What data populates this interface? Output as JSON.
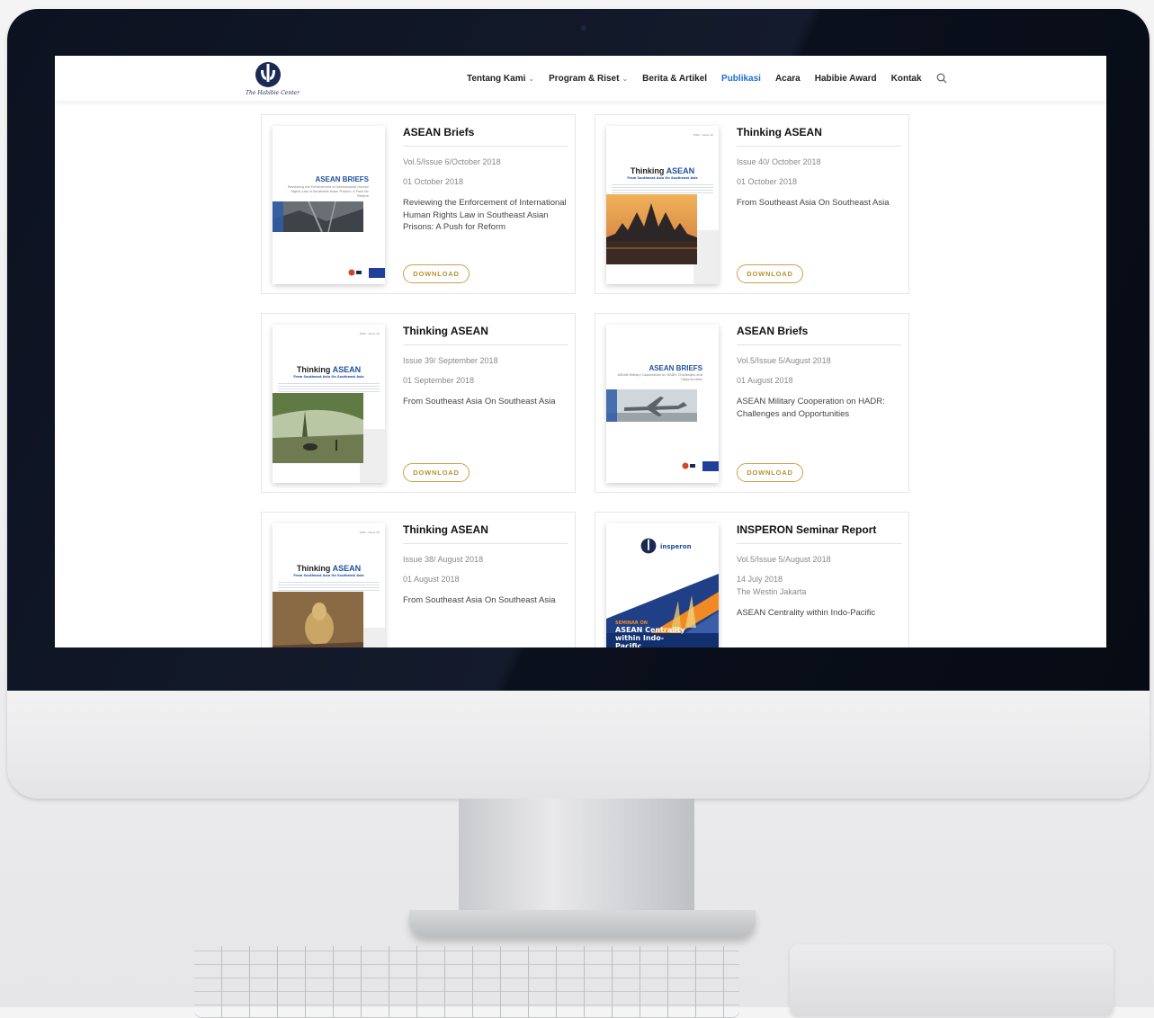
{
  "header": {
    "logo_text": "The Habibie Center",
    "nav": [
      {
        "label": "Tentang Kami",
        "has_caret": true
      },
      {
        "label": "Program & Riset",
        "has_caret": true
      },
      {
        "label": "Berita & Artikel",
        "has_caret": false
      },
      {
        "label": "Publikasi",
        "has_caret": false,
        "active": true
      },
      {
        "label": "Acara",
        "has_caret": false
      },
      {
        "label": "Habibie Award",
        "has_caret": false
      },
      {
        "label": "Kontak",
        "has_caret": false
      }
    ],
    "search_icon": "search-icon"
  },
  "publications": [
    {
      "title": "ASEAN Briefs",
      "issue": "Vol.5/Issue 6/October 2018",
      "date": "01 October 2018",
      "description": "Reviewing the Enforcement of International Human Rights Law in Southeast Asian Prisons: A Push for Reform",
      "button": "DOWNLOAD",
      "cover": {
        "heading": "ASEAN BRIEFS",
        "subtitle": "Reviewing the Enforcement of International Human Rights Law in Southeast Asian Prisons: A Push for Reform"
      }
    },
    {
      "title": "Thinking ASEAN",
      "issue": "Issue 40/ October 2018",
      "date": "01 October 2018",
      "description": "From Southeast Asia On Southeast Asia",
      "button": "DOWNLOAD",
      "cover": {
        "heading_a": "Thinking ",
        "heading_b": "ASEAN",
        "subtitle": "From Southeast Asia On Southeast Asia"
      }
    },
    {
      "title": "Thinking ASEAN",
      "issue": "Issue 39/ September 2018",
      "date": "01 September 2018",
      "description": "From Southeast Asia On Southeast Asia",
      "button": "DOWNLOAD",
      "cover": {
        "heading_a": "Thinking ",
        "heading_b": "ASEAN",
        "subtitle": "From Southeast Asia On Southeast Asia"
      }
    },
    {
      "title": "ASEAN Briefs",
      "issue": "Vol.5/Issue 5/August 2018",
      "date": "01 August 2018",
      "description": "ASEAN Military Cooperation on HADR: Challenges and Opportunities",
      "button": "DOWNLOAD",
      "cover": {
        "heading": "ASEAN BRIEFS",
        "subtitle": "ASEAN Military Cooperation on HADR: Challenges and Opportunities"
      }
    },
    {
      "title": "Thinking ASEAN",
      "issue": "Issue 38/ August 2018",
      "date": "01 August 2018",
      "description": "From Southeast Asia On Southeast Asia",
      "cover": {
        "heading_a": "Thinking ",
        "heading_b": "ASEAN",
        "subtitle": "From Southeast Asia On Southeast Asia"
      }
    },
    {
      "title": "INSPERON Seminar Report",
      "issue": "Vol.5/Issue 5/August 2018",
      "date": "14 July 2018",
      "location": "The Westin Jakarta",
      "description": "ASEAN Centrality within Indo-Pacific",
      "cover": {
        "brand": "insperon",
        "kicker": "SEMINAR ON",
        "heading": "ASEAN Centrality within Indo-Pacific"
      }
    }
  ],
  "colors": {
    "accent": "#1f6fd6",
    "button": "#c8a24a",
    "brand_blue": "#1f4f9e"
  }
}
